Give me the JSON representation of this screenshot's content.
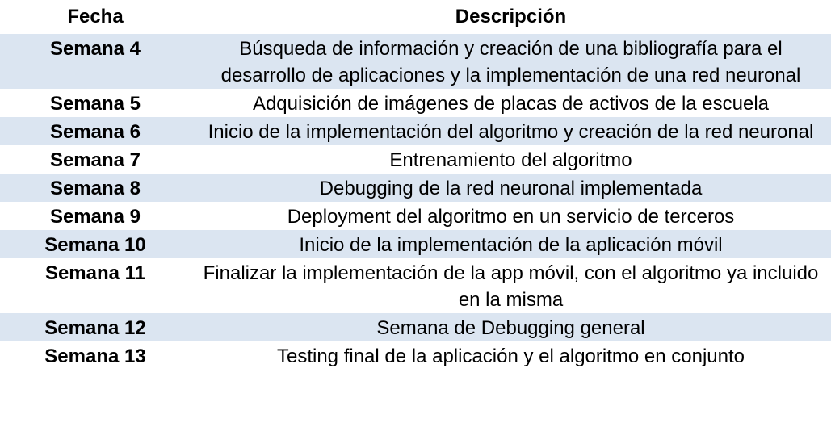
{
  "table": {
    "headers": {
      "fecha": "Fecha",
      "descripcion": "Descripción"
    },
    "rows": [
      {
        "fecha": "Semana 4",
        "descripcion": "Búsqueda de información y creación de una bibliografía para el desarrollo de aplicaciones y la implementación de una red neuronal",
        "shaded": true
      },
      {
        "fecha": "Semana 5",
        "descripcion": "Adquisición de imágenes de placas de activos de la escuela",
        "shaded": false
      },
      {
        "fecha": "Semana 6",
        "descripcion": "Inicio de la implementación del algoritmo y creación de la red neuronal",
        "shaded": true
      },
      {
        "fecha": "Semana 7",
        "descripcion": "Entrenamiento del algoritmo",
        "shaded": false
      },
      {
        "fecha": "Semana 8",
        "descripcion": "Debugging de la red neuronal implementada",
        "shaded": true
      },
      {
        "fecha": "Semana 9",
        "descripcion": "Deployment del algoritmo en un servicio de terceros",
        "shaded": false
      },
      {
        "fecha": "Semana 10",
        "descripcion": "Inicio de la implementación de la aplicación móvil",
        "shaded": true
      },
      {
        "fecha": "Semana 11",
        "descripcion": "Finalizar la implementación de la app móvil, con el algoritmo ya incluido en la misma",
        "shaded": false
      },
      {
        "fecha": "Semana 12",
        "descripcion": "Semana de Debugging general",
        "shaded": true
      },
      {
        "fecha": "Semana 13",
        "descripcion": "Testing final de la aplicación y el algoritmo en conjunto",
        "shaded": false
      }
    ],
    "colors": {
      "shaded_row": "#dbe5f1",
      "text": "#000000"
    }
  }
}
